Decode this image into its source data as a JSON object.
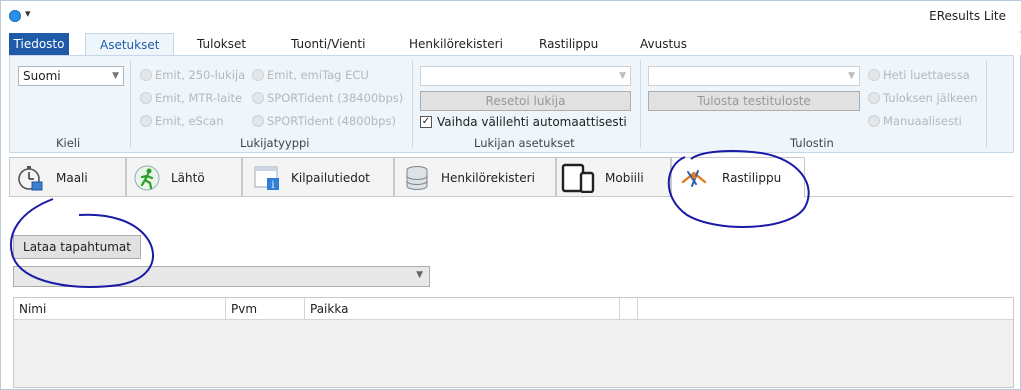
{
  "window": {
    "title": "EResults Lite"
  },
  "menu": {
    "file": "Tiedosto",
    "tabs": [
      "Asetukset",
      "Tulokset",
      "Tuonti/Vienti",
      "Henkilörekisteri",
      "Rastilippu",
      "Avustus"
    ],
    "active": "Asetukset"
  },
  "ribbon": {
    "language": {
      "value": "Suomi",
      "group_label": "Kieli"
    },
    "reader_type": {
      "group_label": "Lukijatyyppi",
      "options_col1": [
        "Emit, 250-lukija",
        "Emit, MTR-laite",
        "Emit, eScan"
      ],
      "options_col2": [
        "Emit, emiTag ECU",
        "SPORTident (38400bps)",
        "SPORTident (4800bps)"
      ]
    },
    "reader_settings": {
      "group_label": "Lukijan asetukset",
      "port_value": "",
      "reset_button": "Resetoi lukija",
      "auto_switch": {
        "label": "Vaihda välilehti automaattisesti",
        "checked": true
      }
    },
    "printer": {
      "group_label": "Tulostin",
      "printer_value": "",
      "test_print_button": "Tulosta testituloste",
      "options": [
        "Heti luettaessa",
        "Tuloksen jälkeen",
        "Manuaalisesti"
      ]
    }
  },
  "main_tabs": [
    {
      "label": "Maali",
      "icon": "stopwatch-icon"
    },
    {
      "label": "Lähtö",
      "icon": "runner-icon"
    },
    {
      "label": "Kilpailutiedot",
      "icon": "info-window-icon"
    },
    {
      "label": "Henkilörekisteri",
      "icon": "database-icon"
    },
    {
      "label": "Mobiili",
      "icon": "mobile-devices-icon"
    },
    {
      "label": "Rastilippu",
      "icon": "rastilippu-logo-icon"
    }
  ],
  "active_main_tab": "Rastilippu",
  "content": {
    "load_button": "Lataa tapahtumat",
    "event_select_value": "",
    "grid_columns": [
      "Nimi",
      "Pvm",
      "Paikka"
    ]
  },
  "colors": {
    "file_tab": "#1e5aa8",
    "ribbon_bg": "#eef6fb",
    "annotation": "#1a1aa6"
  }
}
